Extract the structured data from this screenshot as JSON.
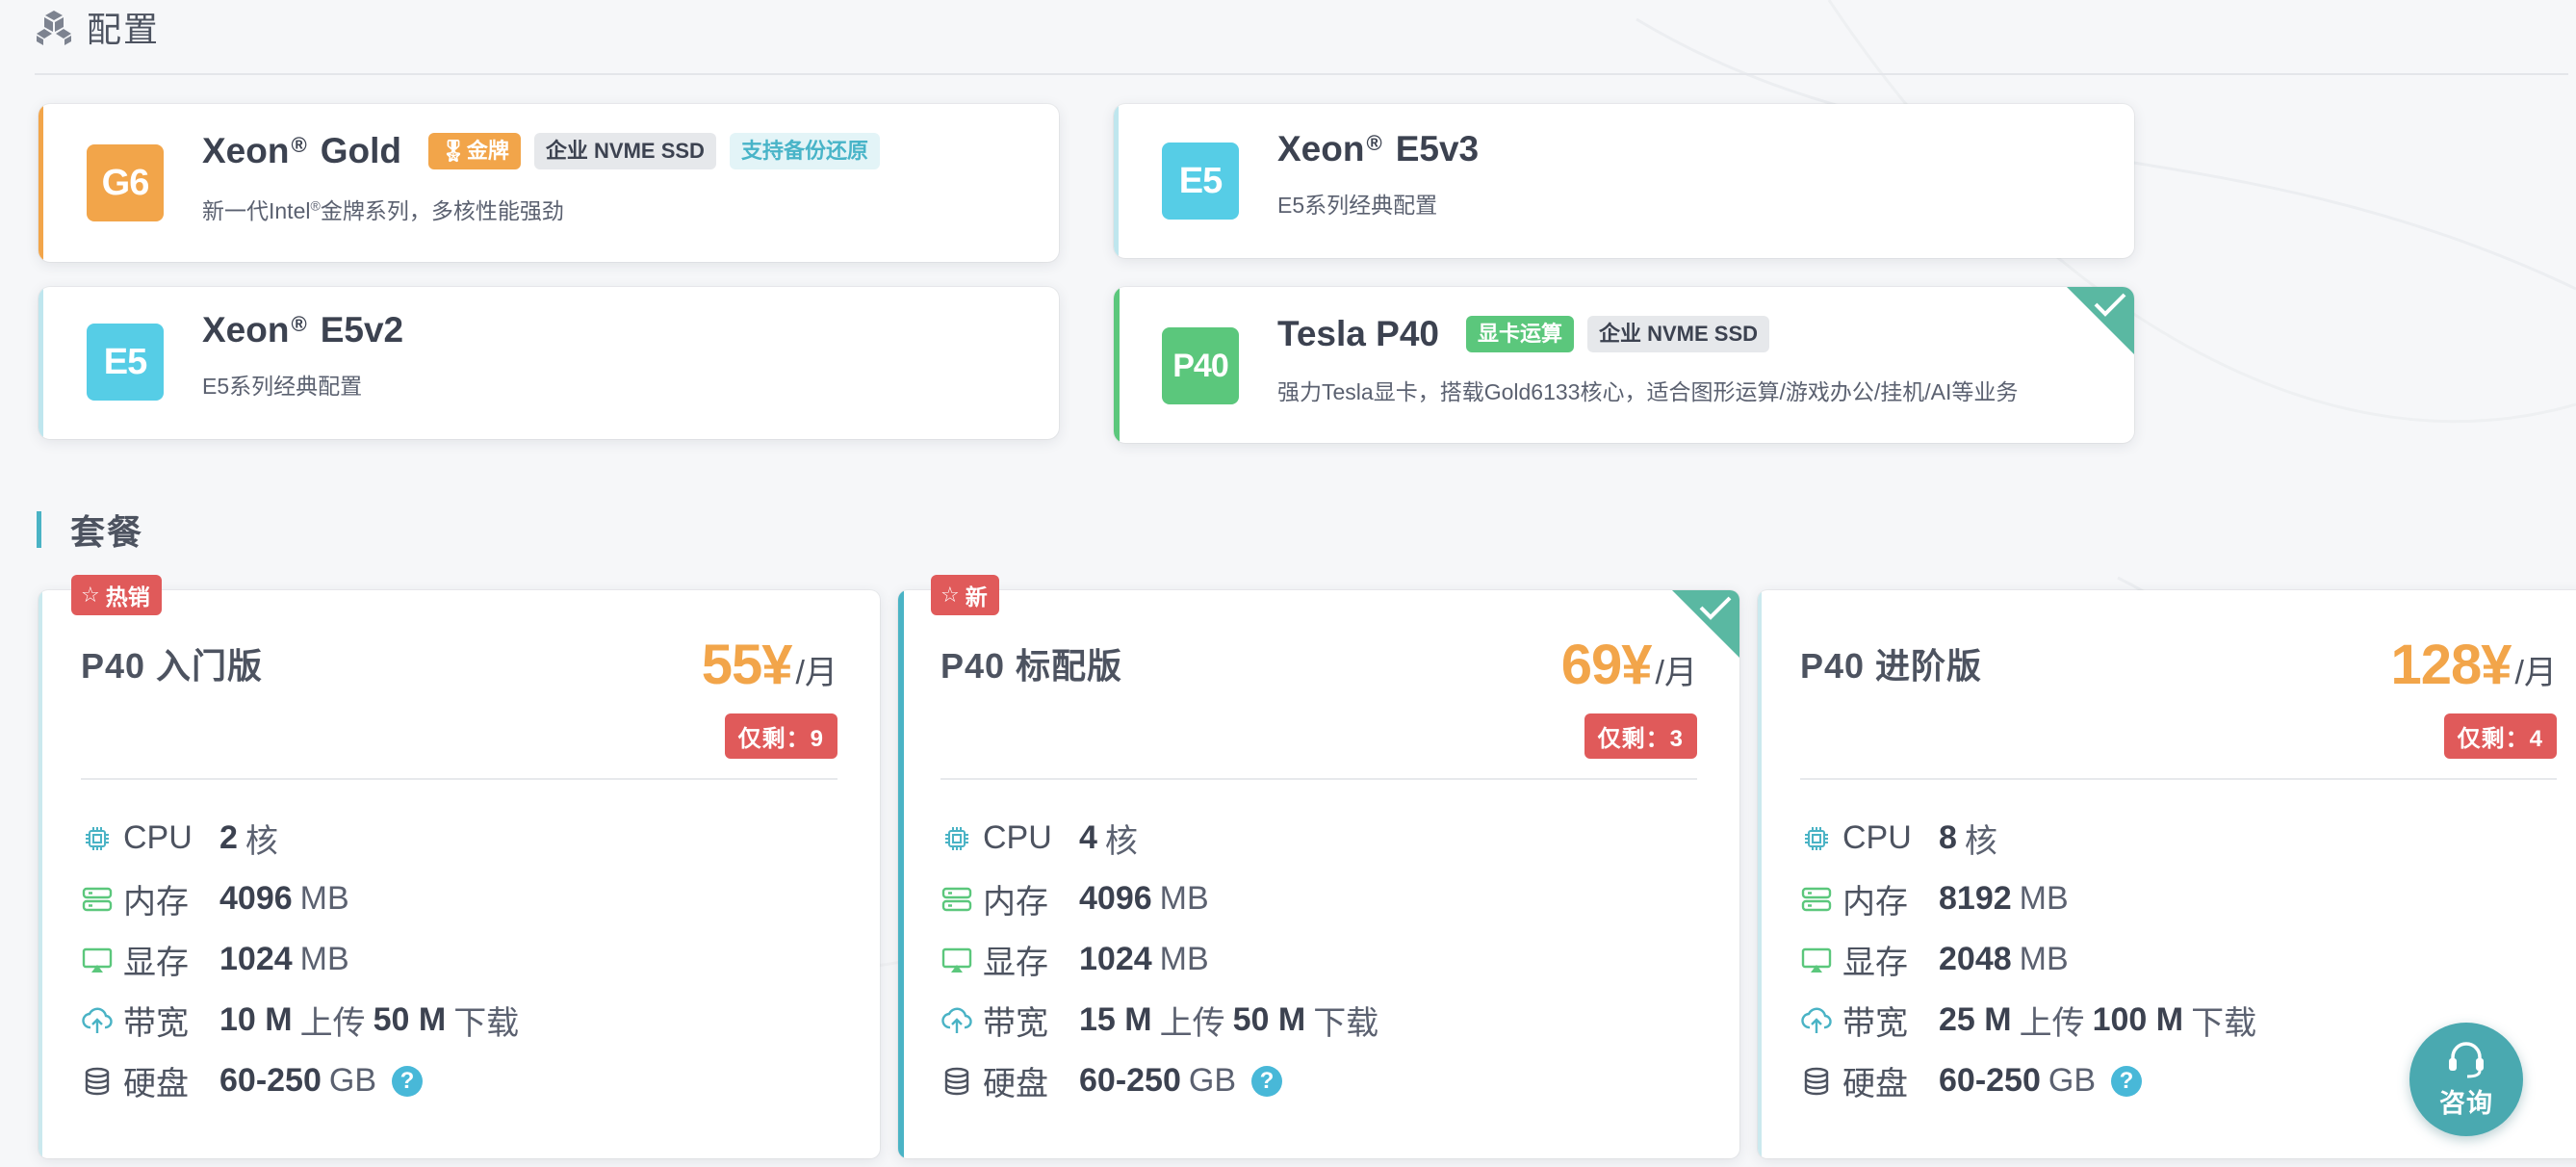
{
  "header": {
    "title": "配置"
  },
  "configs": [
    {
      "badge": "G6",
      "name": "Xeon",
      "reg": "®",
      "suffix": "Gold",
      "tags": [
        "金牌",
        "企业 NVME SSD",
        "支持备份还原"
      ],
      "desc_pre": "新一代Intel",
      "desc_reg": "®",
      "desc_post": "金牌系列，多核性能强劲"
    },
    {
      "badge": "E5",
      "name": "Xeon",
      "reg": "®",
      "suffix": "E5v3",
      "desc": "E5系列经典配置"
    },
    {
      "badge": "E5",
      "name": "Xeon",
      "reg": "®",
      "suffix": "E5v2",
      "desc": "E5系列经典配置"
    },
    {
      "badge": "P40",
      "name": "Tesla P40",
      "tags": [
        "显卡运算",
        "企业 NVME SSD"
      ],
      "desc": "强力Tesla显卡，搭载Gold6133核心，适合图形运算/游戏办公/挂机/AI等业务",
      "selected": true
    }
  ],
  "packages_title": "套餐",
  "plans": [
    {
      "flag": "热销",
      "name": "P40 入门版",
      "price": "55¥",
      "unit": "/月",
      "stock": "仅剩：9",
      "cpu_label": "CPU",
      "cpu": "2",
      "cpu_unit": "核",
      "mem_label": "内存",
      "mem": "4096",
      "mem_unit": "MB",
      "vram_label": "显存",
      "vram": "1024",
      "vram_unit": "MB",
      "bw_label": "带宽",
      "up": "10 M",
      "up_label": "上传",
      "down": "50 M",
      "down_label": "下载",
      "disk_label": "硬盘",
      "disk": "60-250",
      "disk_unit": "GB",
      "help": "?"
    },
    {
      "flag": "新",
      "name": "P40 标配版",
      "price": "69¥",
      "unit": "/月",
      "stock": "仅剩：3",
      "selected": true,
      "cpu_label": "CPU",
      "cpu": "4",
      "cpu_unit": "核",
      "mem_label": "内存",
      "mem": "4096",
      "mem_unit": "MB",
      "vram_label": "显存",
      "vram": "1024",
      "vram_unit": "MB",
      "bw_label": "带宽",
      "up": "15 M",
      "up_label": "上传",
      "down": "50 M",
      "down_label": "下载",
      "disk_label": "硬盘",
      "disk": "60-250",
      "disk_unit": "GB",
      "help": "?"
    },
    {
      "name": "P40 进阶版",
      "price": "128¥",
      "unit": "/月",
      "stock": "仅剩：4",
      "cpu_label": "CPU",
      "cpu": "8",
      "cpu_unit": "核",
      "mem_label": "内存",
      "mem": "8192",
      "mem_unit": "MB",
      "vram_label": "显存",
      "vram": "2048",
      "vram_unit": "MB",
      "bw_label": "带宽",
      "up": "25 M",
      "up_label": "上传",
      "down": "100 M",
      "down_label": "下载",
      "disk_label": "硬盘",
      "disk": "60-250",
      "disk_unit": "GB",
      "help": "?"
    }
  ],
  "consult": {
    "label": "咨询"
  },
  "colors": {
    "accent": "#4ab3c5",
    "price": "#f2a54a",
    "danger": "#e05a5a",
    "gold": "#f2a54a",
    "green": "#5bc77c",
    "check": "#5ab8a2"
  },
  "icons": [
    "cube-icon",
    "check-icon",
    "star-icon",
    "cpu-icon",
    "memory-icon",
    "display-icon",
    "upload-icon",
    "database-icon",
    "help-icon",
    "headset-icon",
    "medal-icon"
  ]
}
